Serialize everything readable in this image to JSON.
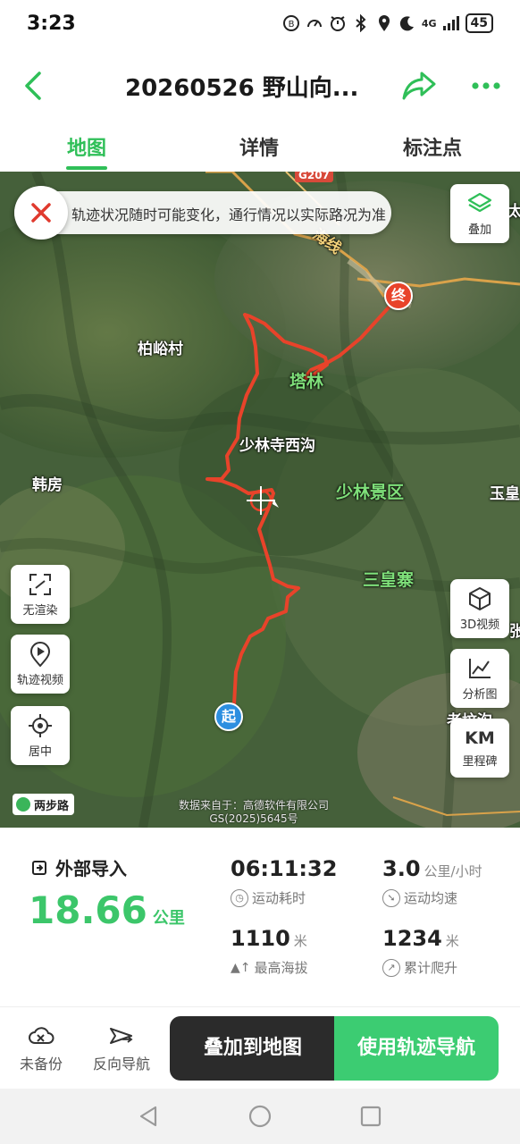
{
  "status_bar": {
    "time": "3:23",
    "network": "4G",
    "battery": "45"
  },
  "header": {
    "title": "20260526 野山向...",
    "back_icon": "chevron-left-icon",
    "share_icon": "share-arrow-icon",
    "more_icon": "more-dots-icon",
    "accent_color": "#2fbf58"
  },
  "tabs": [
    {
      "label": "地图",
      "active": true
    },
    {
      "label": "详情",
      "active": false
    },
    {
      "label": "标注点",
      "active": false
    }
  ],
  "map": {
    "notice": "轨迹状况随时可能变化，通行情况以实际路况为准",
    "road_shield": "G207",
    "labels": {
      "bairu": "柏峪村",
      "talin": "塔林",
      "shaolin_west": "少林寺西沟",
      "hanfang": "韩房",
      "scenic": "少林景区",
      "sanhuang": "三皇寨",
      "yuhuang": "玉皇",
      "road_name": "海线",
      "right_edge_1": "太",
      "right_edge_2": "老坟沟",
      "right_edge_3": "张"
    },
    "start_label": "起",
    "end_label": "终",
    "buttons": {
      "layers": "叠加",
      "no_render": "无渲染",
      "track_video": "轨迹视频",
      "center": "居中",
      "view_3d": "3D视频",
      "analysis": "分析图",
      "km_top": "KM",
      "milestone": "里程碑"
    },
    "brand": "两步路",
    "attribution_line1": "数据来自于：高德软件有限公司",
    "attribution_line2": "GS(2025)5645号",
    "route_color": "#e8432a"
  },
  "stats": {
    "source": "外部导入",
    "distance_value": "18.66",
    "distance_unit": "公里",
    "duration": {
      "value": "06:11:32",
      "label": "运动耗时"
    },
    "avg_speed": {
      "value": "3.0",
      "unit": "公里/小时",
      "label": "运动均速"
    },
    "max_altitude": {
      "value": "1110",
      "unit": "米",
      "label": "最高海拔"
    },
    "total_climb": {
      "value": "1234",
      "unit": "米",
      "label": "累计爬升"
    }
  },
  "actions": {
    "backup": "未备份",
    "reverse_nav": "反向导航",
    "overlay_map": "叠加到地图",
    "use_track_nav": "使用轨迹导航"
  }
}
